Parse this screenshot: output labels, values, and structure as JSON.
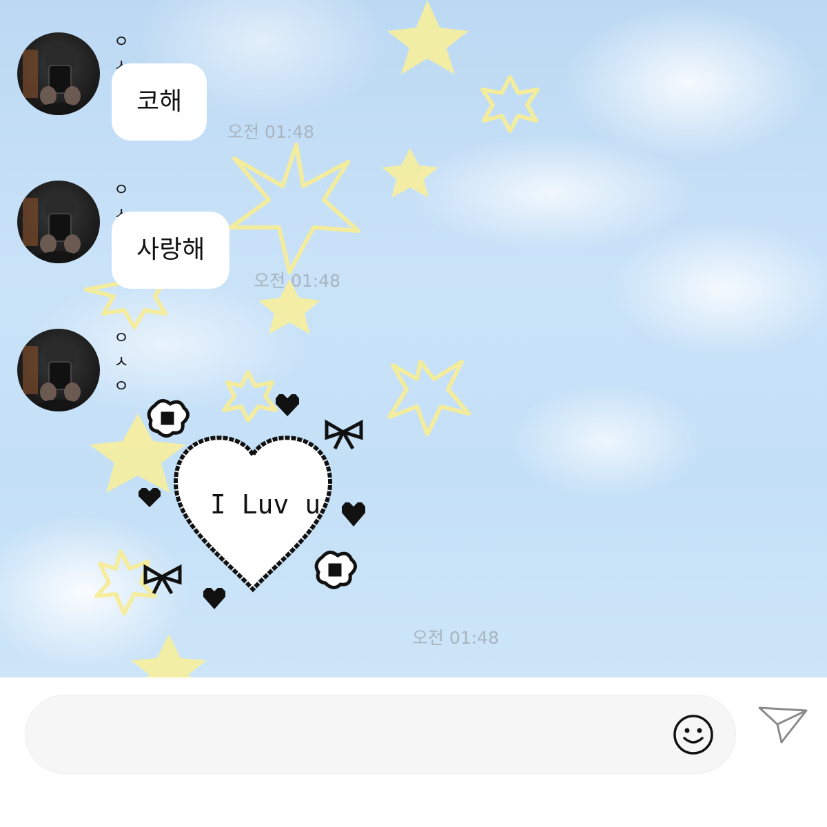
{
  "messages": [
    {
      "sender": "ㅇㅅㅇ",
      "text": "코해",
      "time": "오전 01:48"
    },
    {
      "sender": "ㅇㅅㅇ",
      "text": "사랑해",
      "time": "오전 01:48"
    },
    {
      "sender": "ㅇㅅㅇ",
      "sticker_text": "I Luv u",
      "time": "오전 01:48"
    }
  ],
  "composer": {
    "placeholder": ""
  },
  "icons": {
    "emoji": "smiley-icon",
    "send": "paper-plane-icon"
  },
  "colors": {
    "star": "#f8ef9e",
    "time_text": "#a9b4be",
    "bubble": "#ffffff"
  }
}
